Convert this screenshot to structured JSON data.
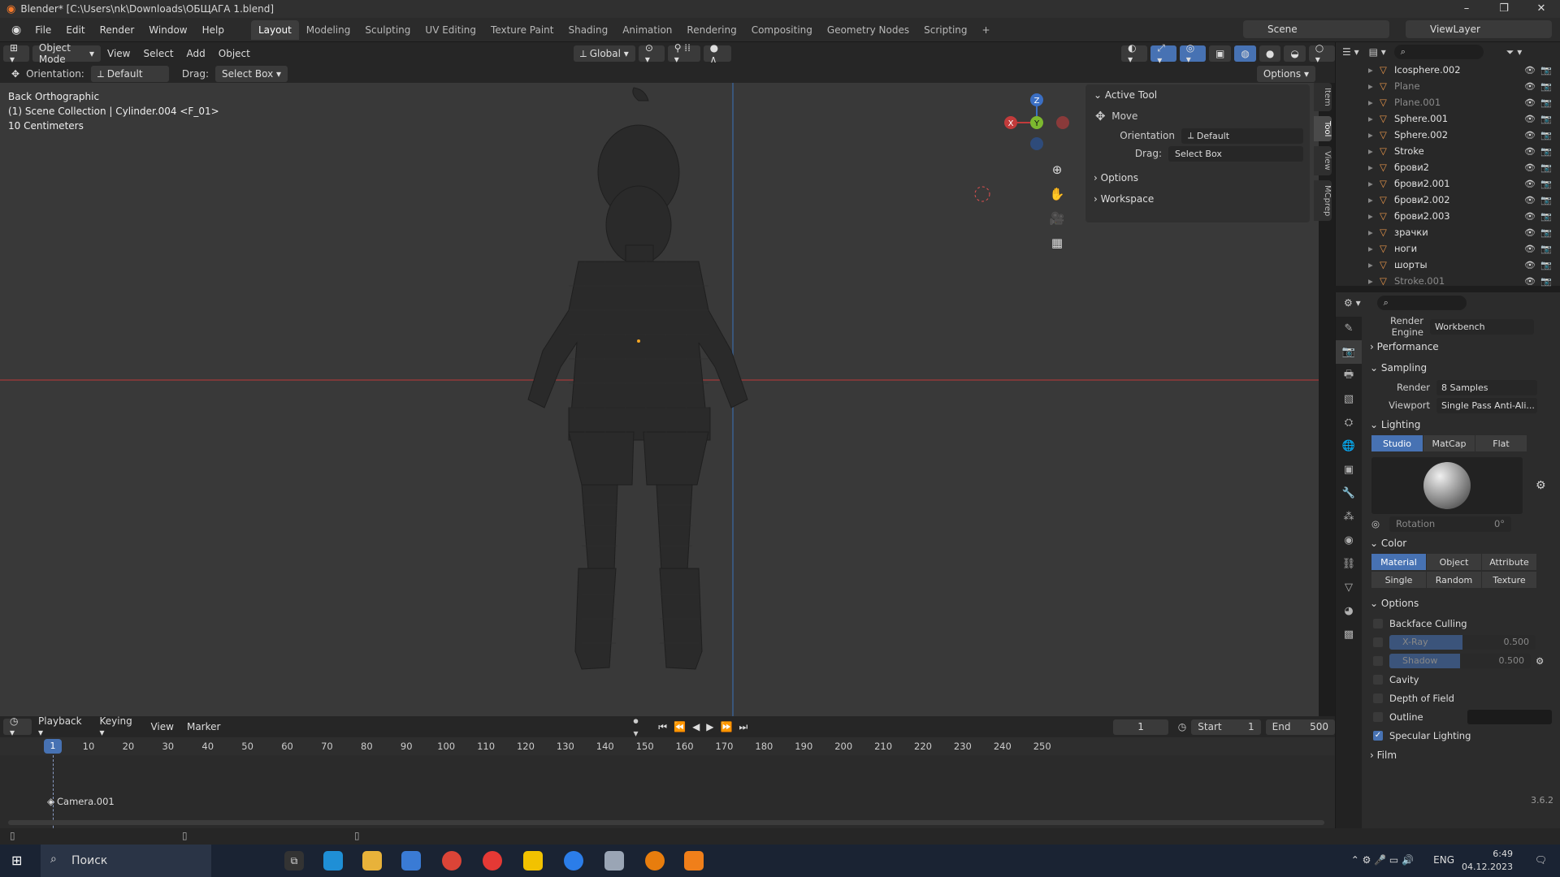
{
  "window": {
    "title": "Blender* [C:\\Users\\nk\\Downloads\\ОБЩАГА 1.blend]"
  },
  "menu": [
    "File",
    "Edit",
    "Render",
    "Window",
    "Help"
  ],
  "workspaces": [
    "Layout",
    "Modeling",
    "Sculpting",
    "UV Editing",
    "Texture Paint",
    "Shading",
    "Animation",
    "Rendering",
    "Compositing",
    "Geometry Nodes",
    "Scripting"
  ],
  "workspace_add": "+",
  "scene_name": "Scene",
  "view_layer": "ViewLayer",
  "viewport_header": {
    "mode": "Object Mode",
    "menus": [
      "View",
      "Select",
      "Add",
      "Object"
    ],
    "orientation": "Global",
    "options_label": "Options"
  },
  "tool_header": {
    "orientation_label": "Orientation:",
    "orientation_value": "Default",
    "drag_label": "Drag:",
    "drag_value": "Select Box"
  },
  "viewport_info": {
    "view_name": "Back Orthographic",
    "collection": "(1) Scene Collection | Cylinder.004 <F_01>",
    "scale": "10 Centimeters"
  },
  "gizmo_axes": {
    "z": "Z",
    "y": "Y",
    "x": "X"
  },
  "npanel": {
    "active_tool_title": "Active Tool",
    "tool_name": "Move",
    "orientation_label": "Orientation",
    "orientation_value": "Default",
    "drag_label": "Drag:",
    "drag_value": "Select Box",
    "options_title": "Options",
    "workspace_title": "Workspace"
  },
  "side_tabs": [
    "Item",
    "Tool",
    "View",
    "MCprep"
  ],
  "outliner": {
    "items": [
      {
        "name": "Icosphere.002",
        "dim": false
      },
      {
        "name": "Plane",
        "dim": true
      },
      {
        "name": "Plane.001",
        "dim": true
      },
      {
        "name": "Sphere.001",
        "dim": false
      },
      {
        "name": "Sphere.002",
        "dim": false
      },
      {
        "name": "Stroke",
        "dim": false
      },
      {
        "name": "брови2",
        "dim": false
      },
      {
        "name": "брови2.001",
        "dim": false
      },
      {
        "name": "брови2.002",
        "dim": false
      },
      {
        "name": "брови2.003",
        "dim": false
      },
      {
        "name": "зрачки",
        "dim": false
      },
      {
        "name": "ноги",
        "dim": false
      },
      {
        "name": "шорты",
        "dim": false
      },
      {
        "name": "Stroke.001",
        "dim": true
      }
    ]
  },
  "properties": {
    "render_engine_label": "Render Engine",
    "render_engine_value": "Workbench",
    "performance": "Performance",
    "sampling": "Sampling",
    "render_label": "Render",
    "render_value": "8 Samples",
    "viewport_label": "Viewport",
    "viewport_value": "Single Pass Anti-Ali...",
    "lighting": "Lighting",
    "lighting_modes": [
      "Studio",
      "MatCap",
      "Flat"
    ],
    "rotation_label": "Rotation",
    "rotation_value": "0°",
    "color": "Color",
    "color_modes_row1": [
      "Material",
      "Object",
      "Attribute"
    ],
    "color_modes_row2": [
      "Single",
      "Random",
      "Texture"
    ],
    "options": "Options",
    "backface": "Backface Culling",
    "xray_label": "X-Ray",
    "xray_value": "0.500",
    "xray_fill": 0.5,
    "shadow_label": "Shadow",
    "shadow_value": "0.500",
    "shadow_fill": 0.5,
    "cavity": "Cavity",
    "dof": "Depth of Field",
    "outline": "Outline",
    "specular": "Specular Lighting",
    "film": "Film"
  },
  "timeline": {
    "menus": [
      "Playback",
      "Keying",
      "View",
      "Marker"
    ],
    "current_frame": "1",
    "start_label": "Start",
    "start_value": "1",
    "end_label": "End",
    "end_value": "500",
    "ticks": [
      "10",
      "20",
      "30",
      "40",
      "50",
      "60",
      "70",
      "80",
      "90",
      "100",
      "110",
      "120",
      "130",
      "140",
      "150",
      "160",
      "170",
      "180",
      "190",
      "200",
      "210",
      "220",
      "230",
      "240",
      "250"
    ],
    "marker_frame": "1",
    "channel": "Camera.001"
  },
  "version": "3.6.2",
  "taskbar": {
    "search_placeholder": "Поиск",
    "lang": "ENG",
    "time": "6:49",
    "date": "04.12.2023"
  }
}
